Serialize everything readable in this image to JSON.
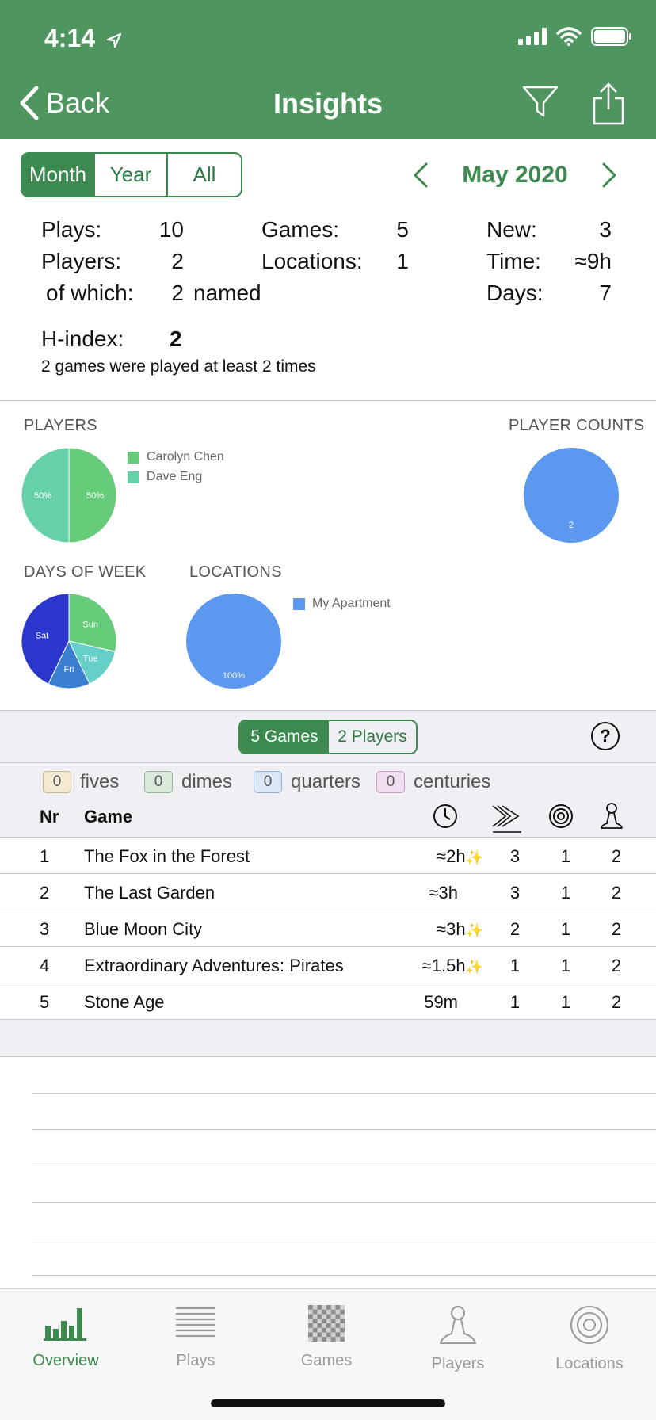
{
  "status": {
    "time": "4:14"
  },
  "nav": {
    "back_label": "Back",
    "title": "Insights"
  },
  "period": {
    "segments": [
      "Month",
      "Year",
      "All"
    ],
    "active": "Month",
    "label": "May 2020"
  },
  "stats": {
    "plays_label": "Plays:",
    "plays": "10",
    "players_label": "Players:",
    "players": "2",
    "of_which_label": "of which:",
    "of_which": "2",
    "named_label": "named",
    "games_label": "Games:",
    "games": "5",
    "locations_label": "Locations:",
    "locations": "1",
    "new_label": "New:",
    "new": "3",
    "time_label": "Time:",
    "time": "≈9h",
    "days_label": "Days:",
    "days": "7",
    "hindex_label": "H-index:",
    "hindex": "2",
    "hindex_note": "2 games were played at least 2 times"
  },
  "chart_data": [
    {
      "type": "pie",
      "title": "PLAYERS",
      "categories": [
        "Carolyn Chen",
        "Dave Eng"
      ],
      "values": [
        50,
        50
      ],
      "labels": [
        "50%",
        "50%"
      ],
      "colors": [
        "#66cc7a",
        "#66d0a8"
      ],
      "legend": "right"
    },
    {
      "type": "pie",
      "title": "PLAYER COUNTS",
      "categories": [
        "2"
      ],
      "values": [
        100
      ],
      "labels": [
        "2"
      ],
      "colors": [
        "#5c98f0"
      ]
    },
    {
      "type": "pie",
      "title": "DAYS OF WEEK",
      "categories": [
        "Sun",
        "Tue",
        "Fri",
        "Sat"
      ],
      "values": [
        2,
        1,
        1,
        3
      ],
      "labels": [
        "Sun",
        "Tue",
        "Fri",
        "Sat"
      ],
      "colors": [
        "#66cc7a",
        "#66d0c8",
        "#3b7fd0",
        "#2a36cc"
      ]
    },
    {
      "type": "pie",
      "title": "LOCATIONS",
      "categories": [
        "My Apartment"
      ],
      "values": [
        100
      ],
      "labels": [
        "100%"
      ],
      "colors": [
        "#5c98f0"
      ],
      "legend": "right"
    }
  ],
  "table_toggle": {
    "games_label": "5 Games",
    "players_label": "2 Players"
  },
  "help_label": "?",
  "milestones": [
    {
      "count": "0",
      "label": "fives",
      "color": "#f3ead2",
      "border": "#c9b98e"
    },
    {
      "count": "0",
      "label": "dimes",
      "color": "#dbe9dc",
      "border": "#8fb497"
    },
    {
      "count": "0",
      "label": "quarters",
      "color": "#dce8f6",
      "border": "#8fb0d6"
    },
    {
      "count": "0",
      "label": "centuries",
      "color": "#f1e0f1",
      "border": "#c89ac8"
    }
  ],
  "table": {
    "headers": {
      "nr": "Nr",
      "game": "Game"
    },
    "rows": [
      {
        "nr": "1",
        "game": "The Fox in the Forest",
        "time": "≈2h",
        "new": true,
        "plays": "3",
        "locations": "1",
        "players": "2"
      },
      {
        "nr": "2",
        "game": "The Last Garden",
        "time": "≈3h",
        "new": false,
        "plays": "3",
        "locations": "1",
        "players": "2"
      },
      {
        "nr": "3",
        "game": "Blue Moon City",
        "time": "≈3h",
        "new": true,
        "plays": "2",
        "locations": "1",
        "players": "2"
      },
      {
        "nr": "4",
        "game": "Extraordinary Adventures: Pirates",
        "time": "≈1.5h",
        "new": true,
        "plays": "1",
        "locations": "1",
        "players": "2"
      },
      {
        "nr": "5",
        "game": "Stone Age",
        "time": "59m",
        "new": false,
        "plays": "1",
        "locations": "1",
        "players": "2"
      }
    ]
  },
  "tabs": [
    {
      "label": "Overview",
      "icon": "bar-chart-icon",
      "active": true
    },
    {
      "label": "Plays",
      "icon": "list-lines-icon",
      "active": false
    },
    {
      "label": "Games",
      "icon": "checkerboard-icon",
      "active": false
    },
    {
      "label": "Players",
      "icon": "pawn-icon",
      "active": false
    },
    {
      "label": "Locations",
      "icon": "target-icon",
      "active": false
    }
  ]
}
